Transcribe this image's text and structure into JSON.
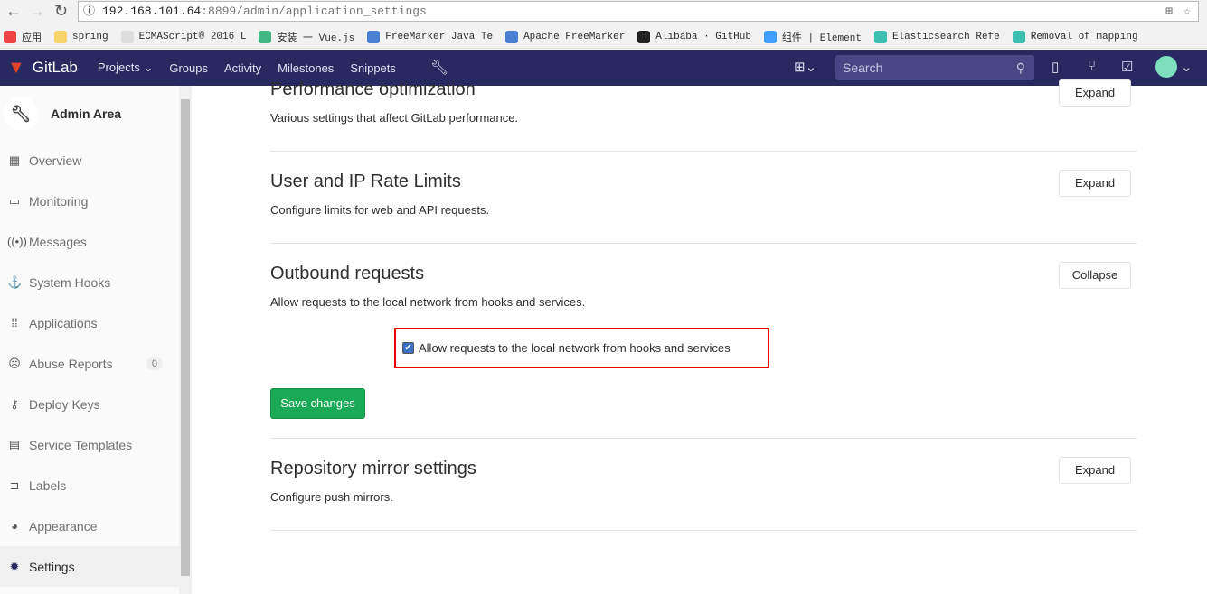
{
  "browser": {
    "url_host": "192.168.101.64",
    "url_rest": ":8899/admin/application_settings",
    "bookmarks": [
      {
        "label": "应用",
        "color": "#e44"
      },
      {
        "label": "spring",
        "color": "#f7d46b"
      },
      {
        "label": "ECMAScript® 2016 L",
        "color": "#ddd"
      },
      {
        "label": "安装 一 Vue.js",
        "color": "#41b883"
      },
      {
        "label": "FreeMarker Java Te",
        "color": "#4a7fd4"
      },
      {
        "label": "Apache FreeMarker",
        "color": "#4a7fd4"
      },
      {
        "label": "Alibaba · GitHub",
        "color": "#222"
      },
      {
        "label": "组件 | Element",
        "color": "#409eff"
      },
      {
        "label": "Elasticsearch Refe",
        "color": "#3cbeb1"
      },
      {
        "label": "Removal of mapping",
        "color": "#3cbeb1"
      }
    ]
  },
  "nav": {
    "brand": "GitLab",
    "links": [
      "Projects ⌄",
      "Groups",
      "Activity",
      "Milestones",
      "Snippets"
    ],
    "search_placeholder": "Search",
    "brand_color": "#292961"
  },
  "sidebar": {
    "title": "Admin Area",
    "items": [
      {
        "label": "Overview",
        "icon": "▦"
      },
      {
        "label": "Monitoring",
        "icon": "▭"
      },
      {
        "label": "Messages",
        "icon": "((•))"
      },
      {
        "label": "System Hooks",
        "icon": "⚓"
      },
      {
        "label": "Applications",
        "icon": "⁞⁞"
      },
      {
        "label": "Abuse Reports",
        "icon": "☹",
        "badge": "0"
      },
      {
        "label": "Deploy Keys",
        "icon": "⚷"
      },
      {
        "label": "Service Templates",
        "icon": "▤"
      },
      {
        "label": "Labels",
        "icon": "⊐"
      },
      {
        "label": "Appearance",
        "icon": "◕"
      },
      {
        "label": "Settings",
        "icon": "✹",
        "active": true
      }
    ]
  },
  "sections": [
    {
      "title": "Performance optimization",
      "desc": "Various settings that affect GitLab performance.",
      "button": "Expand"
    },
    {
      "title": "User and IP Rate Limits",
      "desc": "Configure limits for web and API requests.",
      "button": "Expand"
    },
    {
      "title": "Outbound requests",
      "desc": "Allow requests to the local network from hooks and services.",
      "button": "Collapse"
    },
    {
      "title": "Repository mirror settings",
      "desc": "Configure push mirrors.",
      "button": "Expand"
    }
  ],
  "outbound": {
    "checkbox_label": "Allow requests to the local network from hooks and services",
    "checked": true,
    "save": "Save changes"
  }
}
